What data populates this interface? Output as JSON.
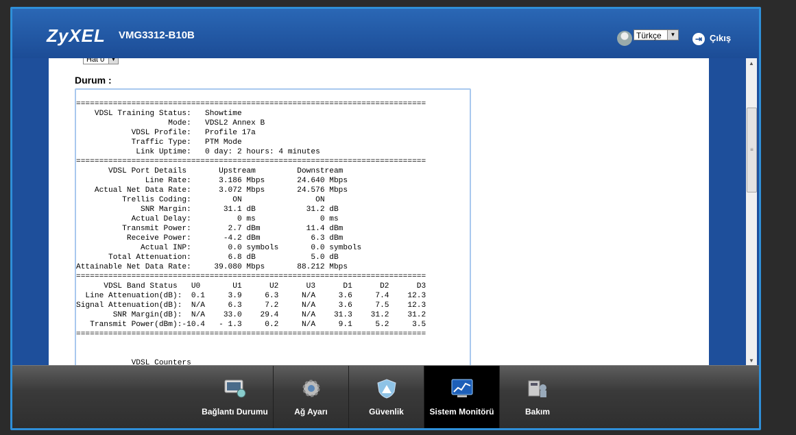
{
  "header": {
    "brand": "ZyXEL",
    "model": "VMG3312-B10B",
    "language": "Türkçe",
    "logout": "Çıkış"
  },
  "content": {
    "line_select": "Hat 0",
    "status_label": "Durum :",
    "status_text": "============================================================================\n    VDSL Training Status:   Showtime\n                    Mode:   VDSL2 Annex B\n            VDSL Profile:   Profile 17a\n            Traffic Type:   PTM Mode\n             Link Uptime:   0 day: 2 hours: 4 minutes\n============================================================================\n       VDSL Port Details       Upstream         Downstream\n               Line Rate:      3.186 Mbps       24.640 Mbps\n    Actual Net Data Rate:      3.072 Mbps       24.576 Mbps\n          Trellis Coding:         ON                ON\n              SNR Margin:       31.1 dB           31.2 dB\n            Actual Delay:          0 ms              0 ms\n          Transmit Power:        2.7 dBm          11.4 dBm\n           Receive Power:       -4.2 dBm           6.3 dBm\n              Actual INP:        0.0 symbols       0.0 symbols\n       Total Attenuation:        6.8 dB            5.0 dB\nAttainable Net Data Rate:     39.080 Mbps       88.212 Mbps\n============================================================================\n      VDSL Band Status   U0       U1      U2      U3      D1      D2      D3\n  Line Attenuation(dB):  0.1     3.9     6.3     N/A     3.6     7.4    12.3\nSignal Attenuation(dB):  N/A     6.3     7.2     N/A     3.6     7.5    12.3\n        SNR Margin(dB):  N/A    33.0    29.4     N/A    31.3    31.2    31.2\n   Transmit Power(dBm):-10.4   - 1.3     0.2     N/A     9.1     5.2     3.5\n============================================================================\n\n\n            VDSL Counters"
  },
  "nav": {
    "items": [
      {
        "label": "Bağlantı Durumu",
        "icon": "connection-status-icon"
      },
      {
        "label": "Ağ Ayarı",
        "icon": "gear-icon"
      },
      {
        "label": "Güvenlik",
        "icon": "shield-icon"
      },
      {
        "label": "Sistem Monitörü",
        "icon": "monitor-chart-icon",
        "active": true
      },
      {
        "label": "Bakım",
        "icon": "maintenance-icon"
      }
    ]
  },
  "colors": {
    "header_blue": "#1e4f9b",
    "frame_border": "#2f8fd8",
    "active_nav": "#000000"
  }
}
